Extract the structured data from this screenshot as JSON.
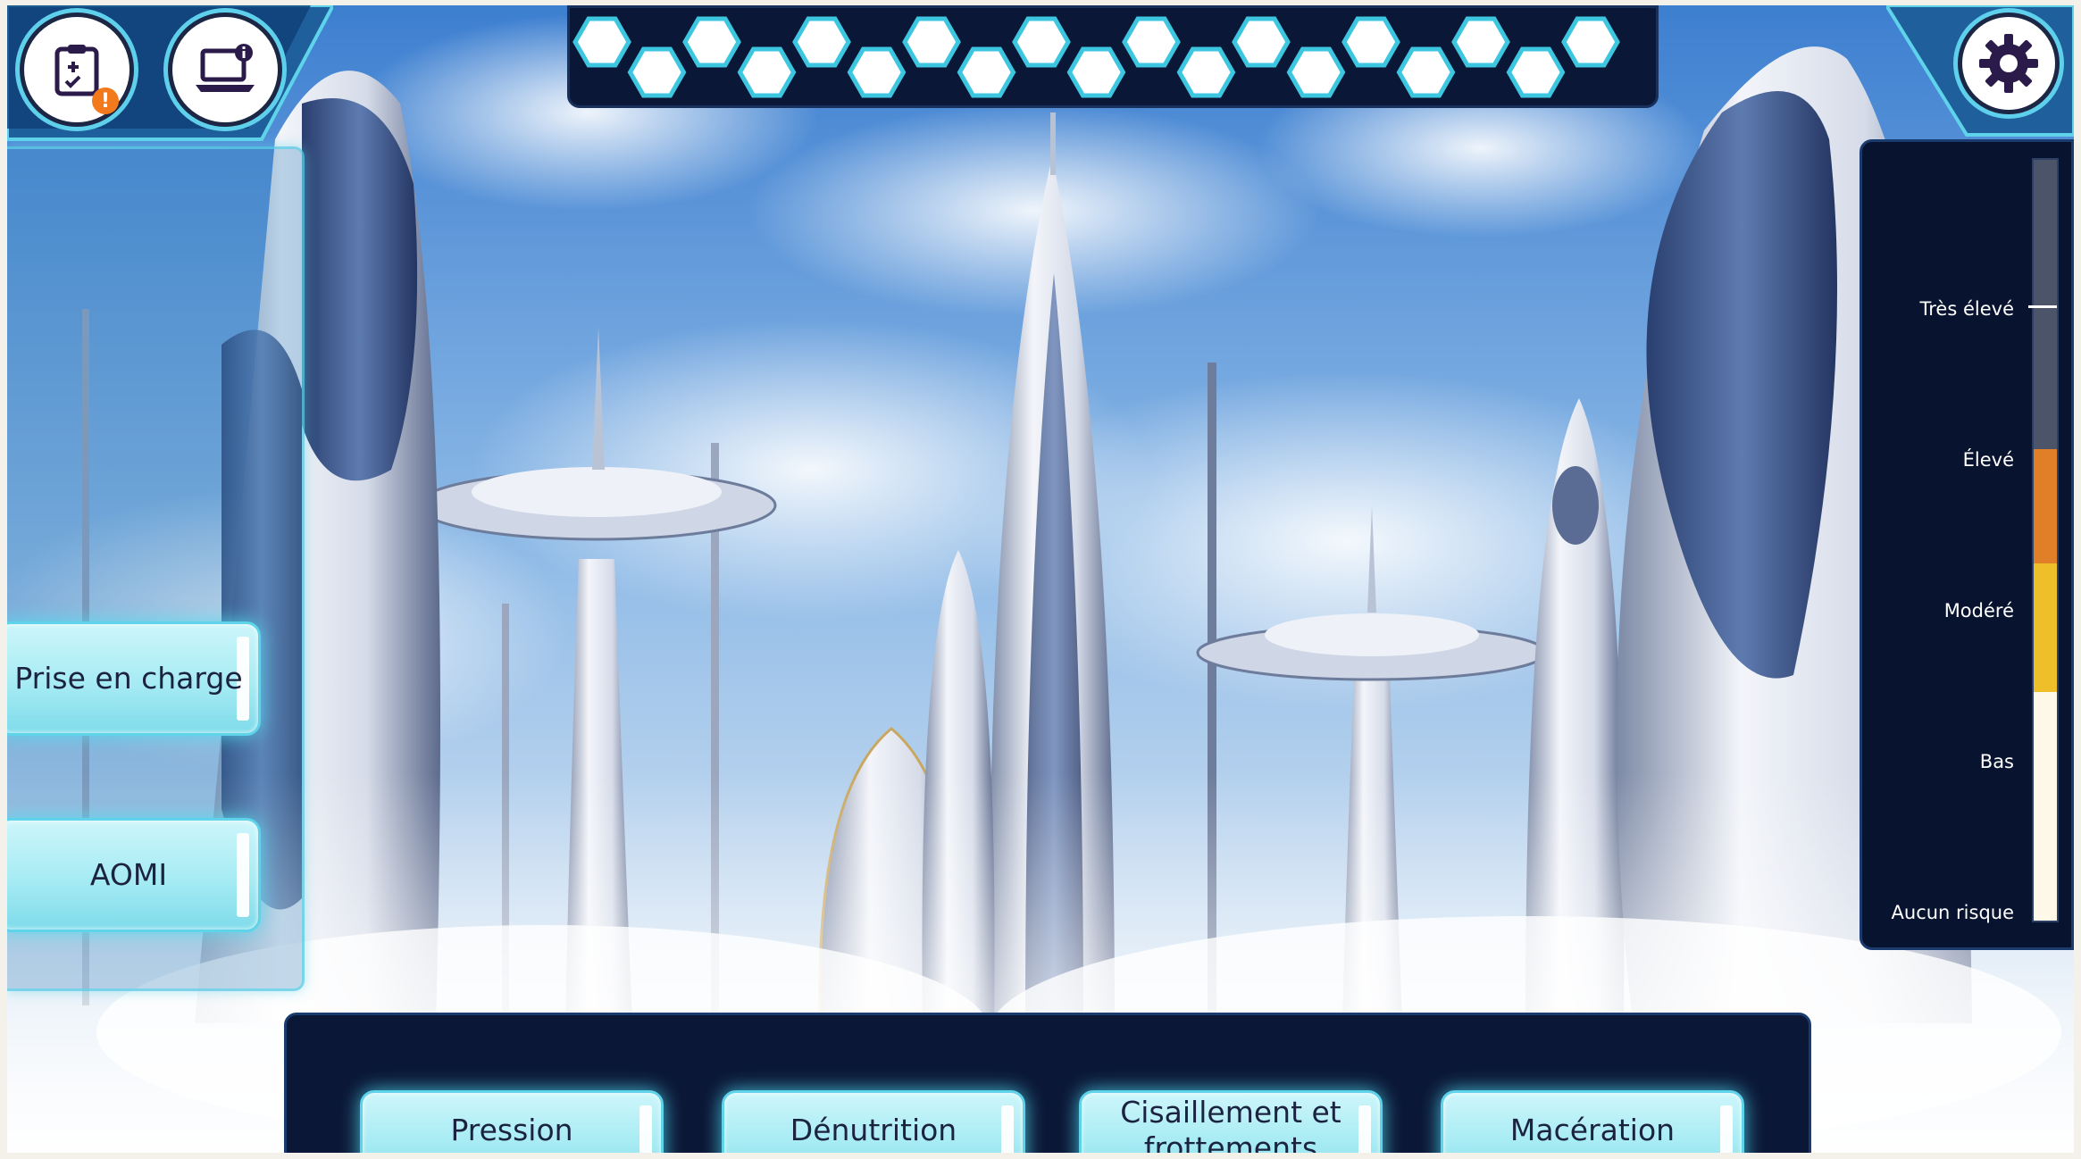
{
  "scene": {
    "description_icon": "futuristic-city-background"
  },
  "top_left": {
    "clipboard_icon": "clipboard-checklist-icon",
    "alert_icon": "exclamation-badge-icon",
    "info_icon": "laptop-info-icon"
  },
  "top_right": {
    "settings_icon": "gear-icon"
  },
  "hex_progress": {
    "total": 19,
    "filled": 0
  },
  "side_menu": {
    "buttons": [
      "Prise en charge",
      "AOMI"
    ]
  },
  "risk_scale": {
    "levels": [
      "Très élevé",
      "Élevé",
      "Modéré",
      "Bas",
      "Aucun risque"
    ],
    "colors": {
      "very_high": "#4b5468",
      "high": "#e07f27",
      "moderate": "#efbf2a",
      "low": "#fdf8e8"
    }
  },
  "bottom_panel": {
    "buttons": [
      "Pression",
      "Dénutrition",
      "Cisaillement et frottements",
      "Macération"
    ]
  },
  "colors": {
    "navy": "#0b1736",
    "glow": "#5fd3ea"
  }
}
